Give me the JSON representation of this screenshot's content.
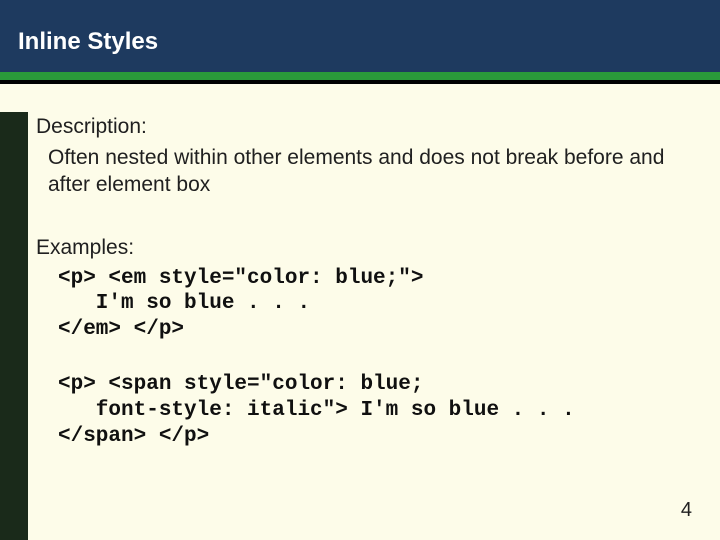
{
  "header": {
    "title": "Inline Styles"
  },
  "body": {
    "descLabel": "Description:",
    "descText": "Often nested within other elements and does not break before and after element box",
    "exLabel": "Examples:",
    "code1": "<p> <em style=\"color: blue;\">\n   I'm so blue . . .\n</em> </p>",
    "code2": "<p> <span style=\"color: blue;\n   font-style: italic\"> I'm so blue . . .\n</span> </p>"
  },
  "pageNumber": "4"
}
